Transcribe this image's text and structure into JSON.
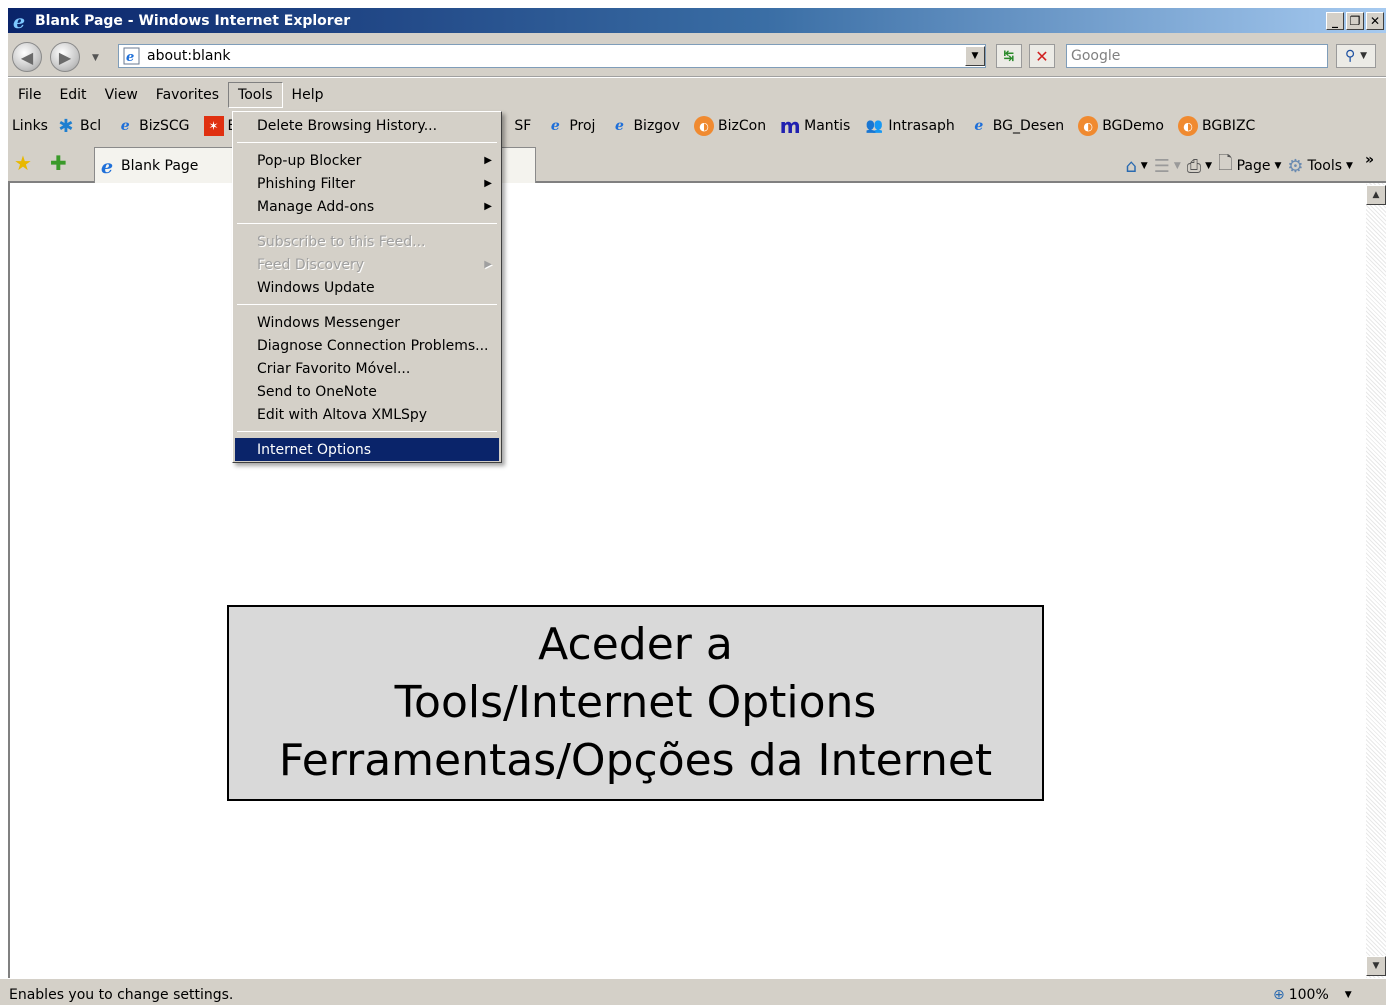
{
  "window": {
    "title": "Blank Page - Windows Internet Explorer",
    "buttons": {
      "minimize": "_",
      "maximize": "❐",
      "close": "✕"
    }
  },
  "address": {
    "value": "about:blank",
    "search_placeholder": "Google"
  },
  "menubar": {
    "items": [
      "File",
      "Edit",
      "View",
      "Favorites",
      "Tools",
      "Help"
    ]
  },
  "links": {
    "label": "Links",
    "items": [
      "Bcl",
      "BizSCG",
      "E",
      "SF",
      "Proj",
      "Bizgov",
      "BizCon",
      "Mantis",
      "Intrasaph",
      "BG_Desen",
      "BGDemo",
      "BGBIZC"
    ]
  },
  "tab": {
    "label": "Blank Page"
  },
  "commandbar": {
    "page": "Page",
    "tools": "Tools"
  },
  "tools_menu": {
    "groups": [
      [
        {
          "label": "Delete Browsing History...",
          "submenu": false,
          "disabled": false
        }
      ],
      [
        {
          "label": "Pop-up Blocker",
          "submenu": true,
          "disabled": false
        },
        {
          "label": "Phishing Filter",
          "submenu": true,
          "disabled": false
        },
        {
          "label": "Manage Add-ons",
          "submenu": true,
          "disabled": false
        }
      ],
      [
        {
          "label": "Subscribe to this Feed...",
          "submenu": false,
          "disabled": true
        },
        {
          "label": "Feed Discovery",
          "submenu": true,
          "disabled": true
        },
        {
          "label": "Windows Update",
          "submenu": false,
          "disabled": false
        }
      ],
      [
        {
          "label": "Windows Messenger",
          "submenu": false,
          "disabled": false
        },
        {
          "label": "Diagnose Connection Problems...",
          "submenu": false,
          "disabled": false
        },
        {
          "label": "Criar Favorito Móvel...",
          "submenu": false,
          "disabled": false
        },
        {
          "label": "Send to OneNote",
          "submenu": false,
          "disabled": false
        },
        {
          "label": "Edit with Altova XMLSpy",
          "submenu": false,
          "disabled": false
        }
      ],
      [
        {
          "label": "Internet Options",
          "submenu": false,
          "disabled": false,
          "highlighted": true
        }
      ]
    ]
  },
  "callout": {
    "lines": [
      "Aceder a",
      "Tools/Internet Options",
      "Ferramentas/Opções da Internet"
    ]
  },
  "status": {
    "message": "Enables you to change settings.",
    "zoom": "100%"
  },
  "colors": {
    "menu_highlight": "#0a246a",
    "chrome": "#d4d0c8",
    "callout_bg": "#d9d9d9"
  }
}
